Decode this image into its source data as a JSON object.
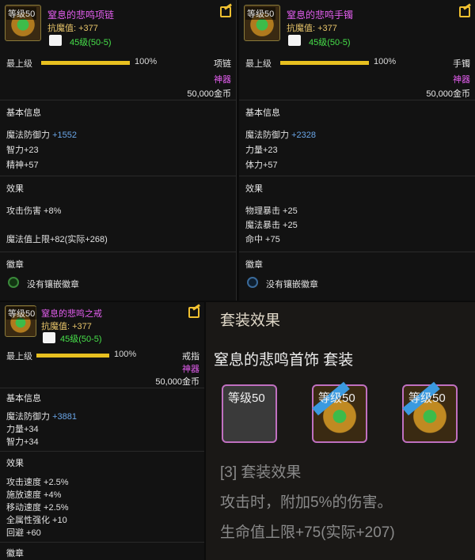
{
  "items": [
    {
      "level_label": "等级50",
      "name": "窒息的悲鸣项链",
      "main_attr": "抗魔值: +377",
      "gem_level": "45级(50-5)",
      "top_level_label": "最上级",
      "top_pct": "100%",
      "type": "项链",
      "rarity": "神器",
      "price": "50,000金币",
      "basic_title": "基本信息",
      "basic_lines": [
        {
          "label": "魔法防御力",
          "value": "+1552"
        },
        {
          "label": "智力+23",
          "value": ""
        },
        {
          "label": "精神+57",
          "value": ""
        }
      ],
      "effect_title": "效果",
      "effect_lines": [
        "攻击伤害 +8%",
        "魔法值上限+82(实际+268)"
      ],
      "emblem_title": "徽章",
      "emblem_text": "没有镶嵌徽章"
    },
    {
      "level_label": "等级50",
      "name": "窒息的悲鸣手镯",
      "main_attr": "抗魔值: +377",
      "gem_level": "45级(50-5)",
      "top_level_label": "最上级",
      "top_pct": "100%",
      "type": "手镯",
      "rarity": "神器",
      "price": "50,000金币",
      "basic_title": "基本信息",
      "basic_lines": [
        {
          "label": "魔法防御力",
          "value": "+2328"
        },
        {
          "label": "力量+23",
          "value": ""
        },
        {
          "label": "体力+57",
          "value": ""
        }
      ],
      "effect_title": "效果",
      "effect_lines": [
        "物理暴击 +25",
        "魔法暴击 +25",
        "命中 +75"
      ],
      "emblem_title": "徽章",
      "emblem_text": "没有镶嵌徽章"
    },
    {
      "level_label": "等级50",
      "name": "窒息的悲鸣之戒",
      "main_attr": "抗魔值: +377",
      "gem_level": "45级(50-5)",
      "top_level_label": "最上级",
      "top_pct": "100%",
      "type": "戒指",
      "rarity": "神器",
      "price": "50,000金币",
      "basic_title": "基本信息",
      "basic_lines": [
        {
          "label": "魔法防御力",
          "value": "+3881"
        },
        {
          "label": "力量+34",
          "value": ""
        },
        {
          "label": "智力+34",
          "value": ""
        }
      ],
      "effect_title": "效果",
      "effect_lines": [
        "攻击速度 +2.5%",
        "施放速度 +4%",
        "移动速度 +2.5%",
        "全属性强化 +10",
        "回避 +60"
      ],
      "emblem_title": "徽章"
    }
  ],
  "set_panel": {
    "title": "套装效果",
    "set_name": "窒息的悲鸣首饰 套装",
    "icons": [
      {
        "label": "等级50",
        "style": "gray"
      },
      {
        "label": "等级50",
        "style": "gold"
      },
      {
        "label": "等级50",
        "style": "gold"
      }
    ],
    "effect_header": "[3] 套装效果",
    "effect_lines": [
      "攻击时，附加5%的伤害。",
      "生命值上限+75(实际+207)"
    ]
  },
  "colors": {
    "item_name": "#e45ef0",
    "main_attr": "#e8c56a",
    "gem_level": "#47e04a",
    "stat_value": "#6aa6e8",
    "bar": "#e8c020"
  }
}
